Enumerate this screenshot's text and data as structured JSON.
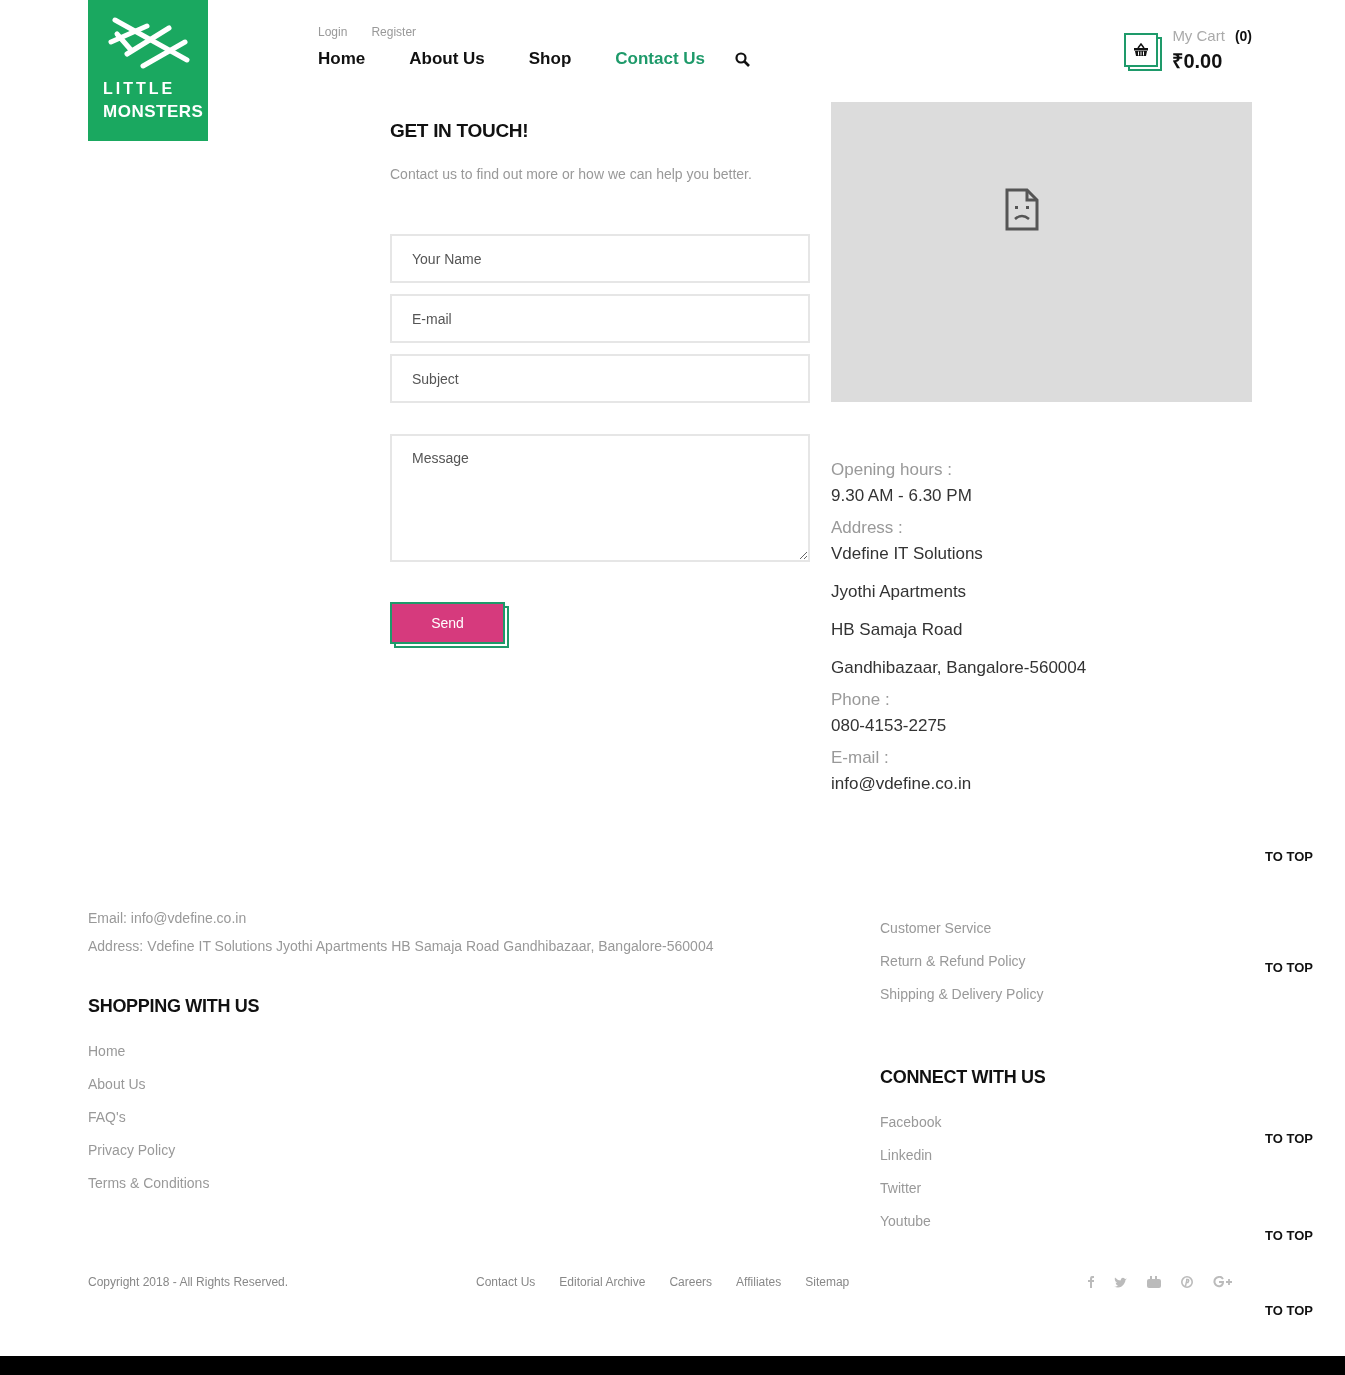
{
  "logo": {
    "line1": "LITTLE",
    "line2": "MONSTERS"
  },
  "account_links": [
    {
      "label": "Login"
    },
    {
      "label": "Register"
    }
  ],
  "nav": [
    {
      "label": "Home",
      "selected": false
    },
    {
      "label": "About Us",
      "selected": false
    },
    {
      "label": "Shop",
      "selected": false
    },
    {
      "label": "Contact Us",
      "selected": true
    }
  ],
  "cart": {
    "label": "My Cart",
    "count": "(0)",
    "total": "₹0.00"
  },
  "contact": {
    "title": "GET IN TOUCH!",
    "intro": "Contact us to find out more or how we can help you better.",
    "fields": [
      {
        "kind": "input",
        "placeholder": "Your Name"
      },
      {
        "kind": "input",
        "placeholder": "E-mail"
      },
      {
        "kind": "input",
        "placeholder": "Subject"
      },
      {
        "kind": "textarea",
        "placeholder": "Message"
      }
    ],
    "send_button": "Send"
  },
  "info": [
    {
      "label": "Opening hours :",
      "lines": [
        "9.30 AM - 6.30 PM"
      ]
    },
    {
      "label": "Address :",
      "lines": [
        "Vdefine IT Solutions",
        "Jyothi Apartments",
        "HB Samaja Road",
        "Gandhibazaar, Bangalore-560004"
      ]
    },
    {
      "label": "Phone :",
      "lines": [
        "080-4153-2275"
      ]
    },
    {
      "label": "E-mail :",
      "lines": [
        "info@vdefine.co.in"
      ]
    }
  ],
  "footer": {
    "contact_lines": [
      "Email: info@vdefine.co.in",
      "Address: Vdefine IT Solutions Jyothi Apartments HB Samaja Road Gandhibazaar, Bangalore-560004"
    ],
    "shopping": {
      "title": "SHOPPING WITH US",
      "links": [
        "Home",
        "About Us",
        "FAQ's",
        "Privacy Policy",
        "Terms & Conditions"
      ]
    },
    "service_links": [
      "Customer Service",
      "Return & Refund Policy",
      "Shipping & Delivery Policy"
    ],
    "connect": {
      "title": "CONNECT WITH US",
      "links": [
        "Facebook",
        "Linkedin",
        "Twitter",
        "Youtube"
      ]
    },
    "copyright": "Copyright 2018 - All Rights Reserved.",
    "bottom_links": [
      "Contact Us",
      "Editorial Archive",
      "Careers",
      "Affiliates",
      "Sitemap"
    ]
  },
  "to_top": [
    "TO TOP",
    "TO TOP",
    "TO TOP",
    "TO TOP",
    "TO TOP"
  ]
}
